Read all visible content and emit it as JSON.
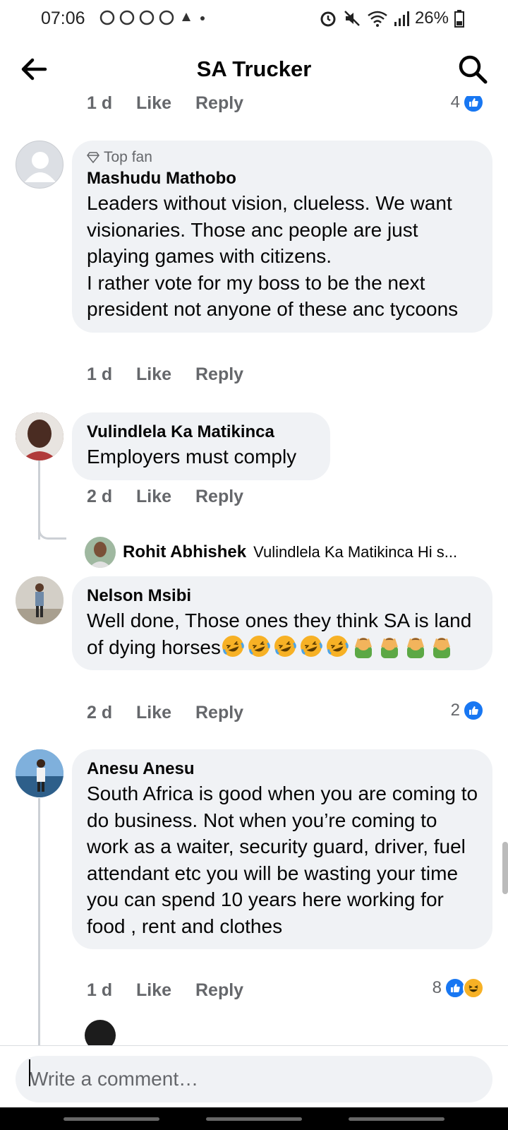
{
  "status": {
    "time": "07:06",
    "notif_icons": "♲♲♲♲",
    "battery": "26%"
  },
  "header": {
    "title": "SA Trucker"
  },
  "top_partial": {
    "time": "1 d",
    "like": "Like",
    "reply": "Reply",
    "reaction_count": "4"
  },
  "comments": [
    {
      "badge": "Top fan",
      "author": "Mashudu Mathobo",
      "text": "Leaders without vision, clueless. We want visionaries. Those anc people are just playing games with citizens.\nI rather vote for my boss to be the next president not anyone of these anc tycoons",
      "time": "1 d",
      "like": "Like",
      "reply": "Reply"
    },
    {
      "author": "Vulindlela Ka Matikinca",
      "text": "Employers must comply",
      "time": "2 d",
      "like": "Like",
      "reply": "Reply",
      "reply_preview": {
        "author": "Rohit Abhishek",
        "text": "Vulindlela Ka Matikinca Hi s..."
      }
    },
    {
      "author": "Nelson Msibi",
      "text": "Well done, Those ones they  think SA is land of dying horses",
      "emojis": [
        "rofl",
        "rofl",
        "rofl",
        "rofl",
        "rofl",
        "facepalm",
        "facepalm",
        "facepalm",
        "facepalm"
      ],
      "time": "2 d",
      "like": "Like",
      "reply": "Reply",
      "reaction_count": "2"
    },
    {
      "author": "Anesu Anesu",
      "text": "South Africa is good when you are coming to do business. Not when you’re coming to work as a waiter, security guard, driver, fuel attendant etc you will be wasting your time you can spend 10 years here working for food , rent and clothes",
      "time": "1 d",
      "like": "Like",
      "reply": "Reply",
      "reaction_count": "8"
    }
  ],
  "composer": {
    "placeholder": "Write a comment…"
  },
  "colors": {
    "accent": "#1877f2",
    "bubble": "#f0f2f5",
    "secondary_text": "#65676b"
  }
}
